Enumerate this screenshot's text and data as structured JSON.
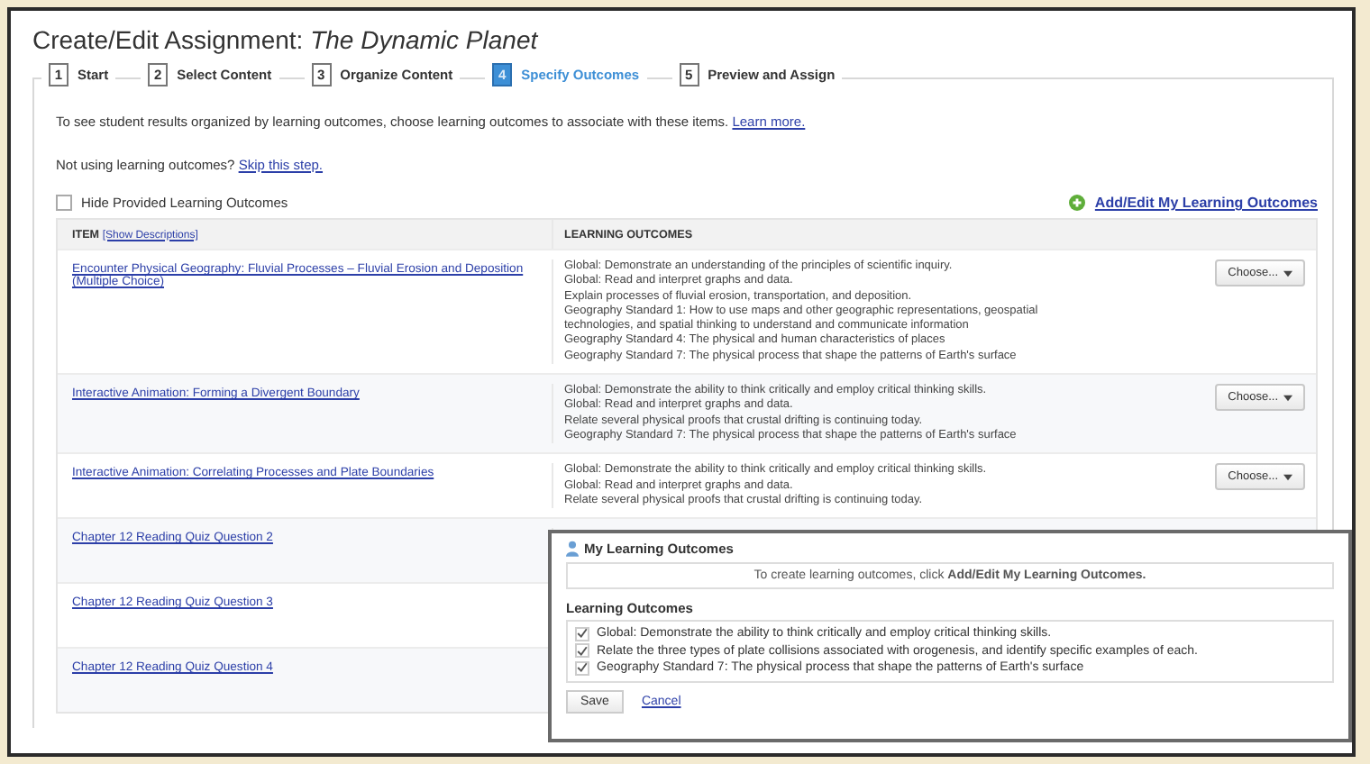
{
  "title": {
    "prefix": "Create/Edit Assignment: ",
    "name": "The Dynamic Planet"
  },
  "steps": [
    {
      "number": "1",
      "label": "Start",
      "selected": false
    },
    {
      "number": "2",
      "label": "Select Content",
      "selected": false
    },
    {
      "number": "3",
      "label": "Organize Content",
      "selected": false
    },
    {
      "number": "4",
      "label": "Specify Outcomes",
      "selected": true
    },
    {
      "number": "5",
      "label": "Preview and Assign",
      "selected": false
    }
  ],
  "intro": {
    "text": "To see student results organized by learning outcomes, choose learning outcomes to associate with these items.",
    "link": "Learn more."
  },
  "skip": {
    "text": "Not using learning outcomes?",
    "link": "Skip this step."
  },
  "hide_provided": {
    "label": "Hide Provided Learning Outcomes",
    "checked": false
  },
  "add_edit_link": "Add/Edit My Learning Outcomes",
  "table": {
    "item_header": "ITEM",
    "show_descriptions": "[Show Descriptions]",
    "outcomes_header": "LEARNING OUTCOMES",
    "rows": [
      {
        "item": "Encounter Physical Geography: Fluvial Processes – Fluvial Erosion and Deposition (Multiple Choice)",
        "outcomes": [
          "Global: Demonstrate an understanding of the principles of scientific inquiry.",
          "Global: Read and interpret graphs and data.",
          "Explain processes of fluvial erosion, transportation, and deposition.",
          "Geography Standard 1: How to use maps and other geographic representations, geospatial technologies, and spatial thinking to understand and communicate information",
          "Geography Standard 4: The physical and human characteristics of places",
          "Geography Standard 7: The physical process that shape the patterns of Earth's surface"
        ],
        "choose": "Choose..."
      },
      {
        "item": "Interactive Animation: Forming a Divergent Boundary",
        "outcomes": [
          "Global: Demonstrate the ability to think critically and employ critical thinking skills.",
          "Global: Read and interpret graphs and data.",
          "Relate several physical proofs that crustal drifting is continuing today.",
          "Geography Standard 7: The physical process that shape the patterns of Earth's surface"
        ],
        "choose": "Choose..."
      },
      {
        "item": "Interactive Animation: Correlating Processes and Plate Boundaries",
        "outcomes": [
          "Global: Demonstrate the ability to think critically and employ critical thinking skills.",
          "Global: Read and interpret graphs and data.",
          "Relate several physical proofs that crustal drifting is continuing today."
        ],
        "choose": "Choose..."
      },
      {
        "item": "Chapter 12 Reading Quiz Question 2"
      },
      {
        "item": "Chapter 12 Reading Quiz Question 3"
      },
      {
        "item": "Chapter 12 Reading Quiz Question 4"
      }
    ]
  },
  "popup": {
    "title": "My Learning Outcomes",
    "info": "To create learning outcomes, click **Add/Edit My Learning Outcomes.**",
    "section": "Learning Outcomes",
    "items": [
      {
        "label": "Global: Demonstrate the ability to think critically and employ critical thinking skills.",
        "checked": true
      },
      {
        "label": "Relate the three types of plate collisions associated with orogenesis, and identify specific examples of each.",
        "checked": true
      },
      {
        "label": "Geography Standard 7: The physical process that shape the patterns of Earth's surface",
        "checked": true
      }
    ],
    "save": "Save",
    "cancel": "Cancel"
  }
}
